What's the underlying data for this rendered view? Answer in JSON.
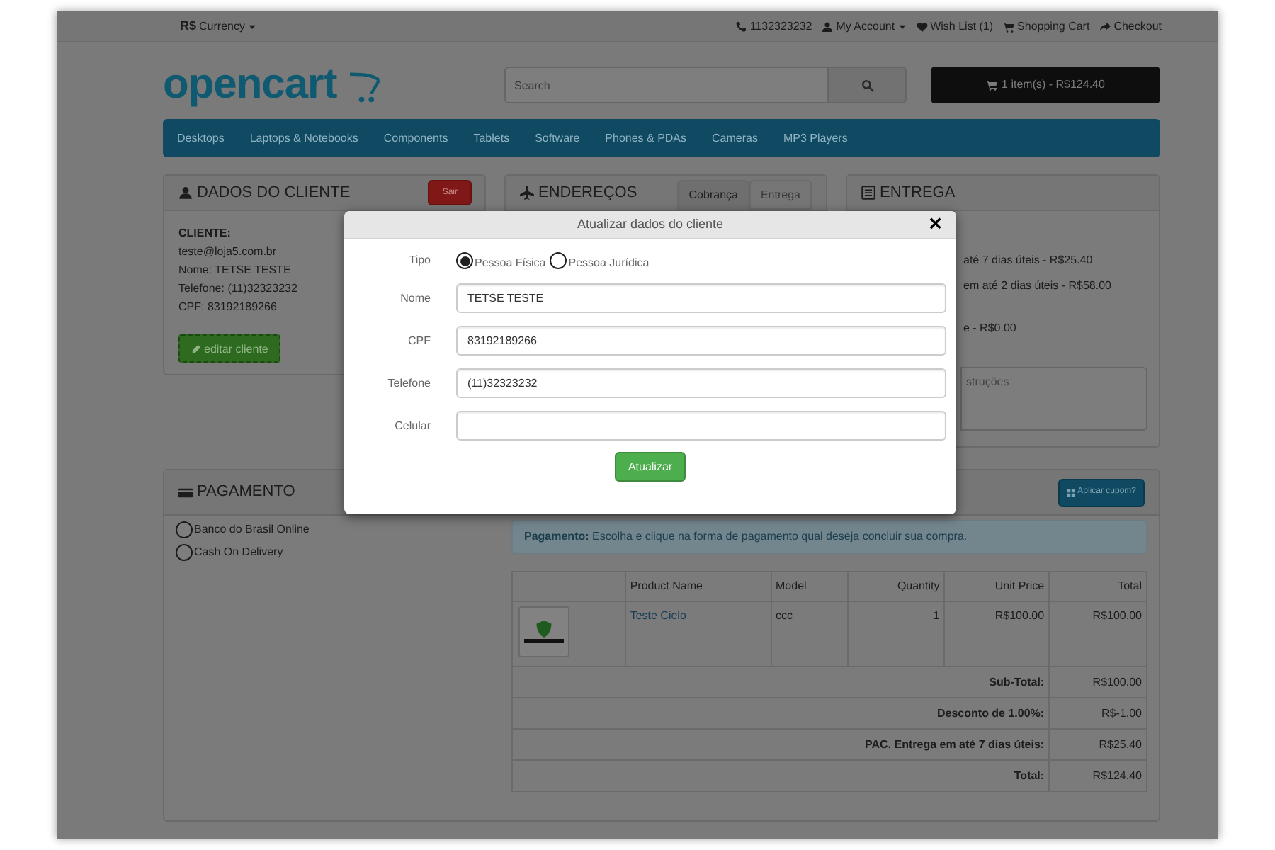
{
  "top_bar": {
    "currency_symbol": "R$",
    "currency_label": "Currency",
    "links": [
      {
        "kind": "phone",
        "label": "1132323232"
      },
      {
        "kind": "account",
        "label": "My Account"
      },
      {
        "kind": "wishlist",
        "label": "Wish List (1)"
      },
      {
        "kind": "cart",
        "label": "Shopping Cart"
      },
      {
        "kind": "checkout",
        "label": "Checkout"
      }
    ]
  },
  "header": {
    "logo": "opencart",
    "search": {
      "placeholder": "Search"
    },
    "cart_button": "1 item(s) - R$124.40"
  },
  "nav": [
    "Desktops",
    "Laptops & Notebooks",
    "Components",
    "Tablets",
    "Software",
    "Phones & PDAs",
    "Cameras",
    "MP3 Players"
  ],
  "customer_panel": {
    "title": "DADOS DO CLIENTE",
    "logout_button": "Sair",
    "label": "CLIENTE:",
    "lines": [
      "teste@loja5.com.br",
      "Nome: TETSE TESTE",
      "Telefone: (11)32323232",
      "CPF: 83192189266"
    ],
    "edit_button": "editar cliente"
  },
  "address_panel": {
    "title": "ENDEREÇOS",
    "tabs": [
      {
        "label": "Cobrança",
        "selected": true
      },
      {
        "label": "Entrega",
        "selected": false
      }
    ]
  },
  "shipping_panel": {
    "title": "ENTREGA",
    "options": [
      "até 7 dias úteis - R$25.40",
      "em até 2 dias úteis - R$58.00",
      "e - R$0.00"
    ],
    "comment_placeholder": "struções"
  },
  "payment_panel": {
    "title": "PAGAMENTO",
    "coupon_button": "Aplicar cupom?",
    "methods": [
      {
        "label": "Banco do Brasil Online",
        "selected": false
      },
      {
        "label": "Cash On Delivery",
        "selected": false
      }
    ],
    "alert": "**Pagamento:** Escolha e clique na forma de pagamento qual deseja concluir sua compra.",
    "table": {
      "columns": [
        "Product Name",
        "Model",
        "Quantity",
        "Unit Price",
        "Total"
      ],
      "rows": [
        {
          "name": "Teste Cielo",
          "model": "ccc",
          "quantity": "1",
          "unit_price": "R$100.00",
          "total": "R$100.00"
        }
      ],
      "totals": [
        {
          "label": "Sub-Total:",
          "value": "R$100.00"
        },
        {
          "label": "Desconto de 1.00%:",
          "value": "R$-1.00"
        },
        {
          "label": "PAC. Entrega em até 7 dias úteis:",
          "value": "R$25.40"
        },
        {
          "label": "Total:",
          "value": "R$124.40"
        }
      ]
    }
  },
  "modal": {
    "title": "Atualizar dados do cliente",
    "close": "×",
    "type_label": "Tipo",
    "type_options": [
      {
        "label": "Pessoa Física",
        "selected": true
      },
      {
        "label": "Pessoa Jurídica",
        "selected": false
      }
    ],
    "fields": [
      {
        "label": "Nome",
        "value": "TETSE TESTE"
      },
      {
        "label": "CPF",
        "value": "83192189266"
      },
      {
        "label": "Telefone",
        "value": "(11)32323232"
      },
      {
        "label": "Celular"
      }
    ],
    "submit": "Atualizar"
  }
}
